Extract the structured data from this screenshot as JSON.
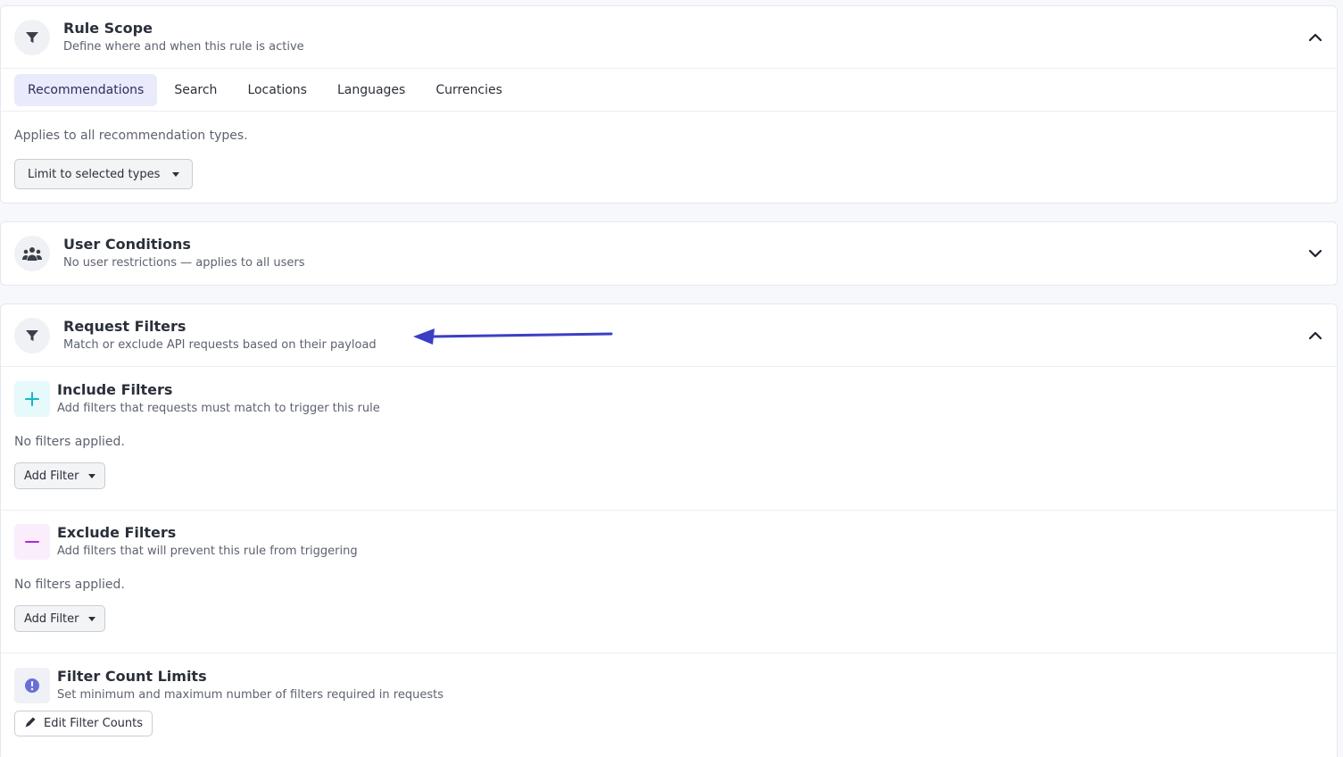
{
  "rule_scope": {
    "title": "Rule Scope",
    "subtitle": "Define where and when this rule is active",
    "tabs": [
      {
        "label": "Recommendations",
        "active": true
      },
      {
        "label": "Search",
        "active": false
      },
      {
        "label": "Locations",
        "active": false
      },
      {
        "label": "Languages",
        "active": false
      },
      {
        "label": "Currencies",
        "active": false
      }
    ],
    "applies_text": "Applies to all recommendation types.",
    "limit_button": "Limit to selected types",
    "icon": "filter-icon",
    "chevron": "chevron-up-icon"
  },
  "user_conditions": {
    "title": "User Conditions",
    "subtitle": "No user restrictions — applies to all users",
    "icon": "users-icon",
    "chevron": "chevron-down-icon"
  },
  "request_filters": {
    "title": "Request Filters",
    "subtitle": "Match or exclude API requests based on their payload",
    "icon": "filter-icon",
    "chevron": "chevron-up-icon",
    "include": {
      "title": "Include Filters",
      "subtitle": "Add filters that requests must match to trigger this rule",
      "empty_text": "No filters applied.",
      "add_button": "Add Filter",
      "icon": "plus-icon",
      "accent": "#14b8c8",
      "bg": "#e6f9fb"
    },
    "exclude": {
      "title": "Exclude Filters",
      "subtitle": "Add filters that will prevent this rule from triggering",
      "empty_text": "No filters applied.",
      "add_button": "Add Filter",
      "icon": "minus-icon",
      "accent": "#b026d9",
      "bg": "#faeefd"
    },
    "limits": {
      "title": "Filter Count Limits",
      "subtitle": "Set minimum and maximum number of filters required in requests",
      "edit_button": "Edit Filter Counts",
      "icon": "info-icon",
      "accent": "#6a6fd8"
    }
  },
  "annotation": {
    "type": "arrow",
    "color": "#3b3fc4"
  }
}
